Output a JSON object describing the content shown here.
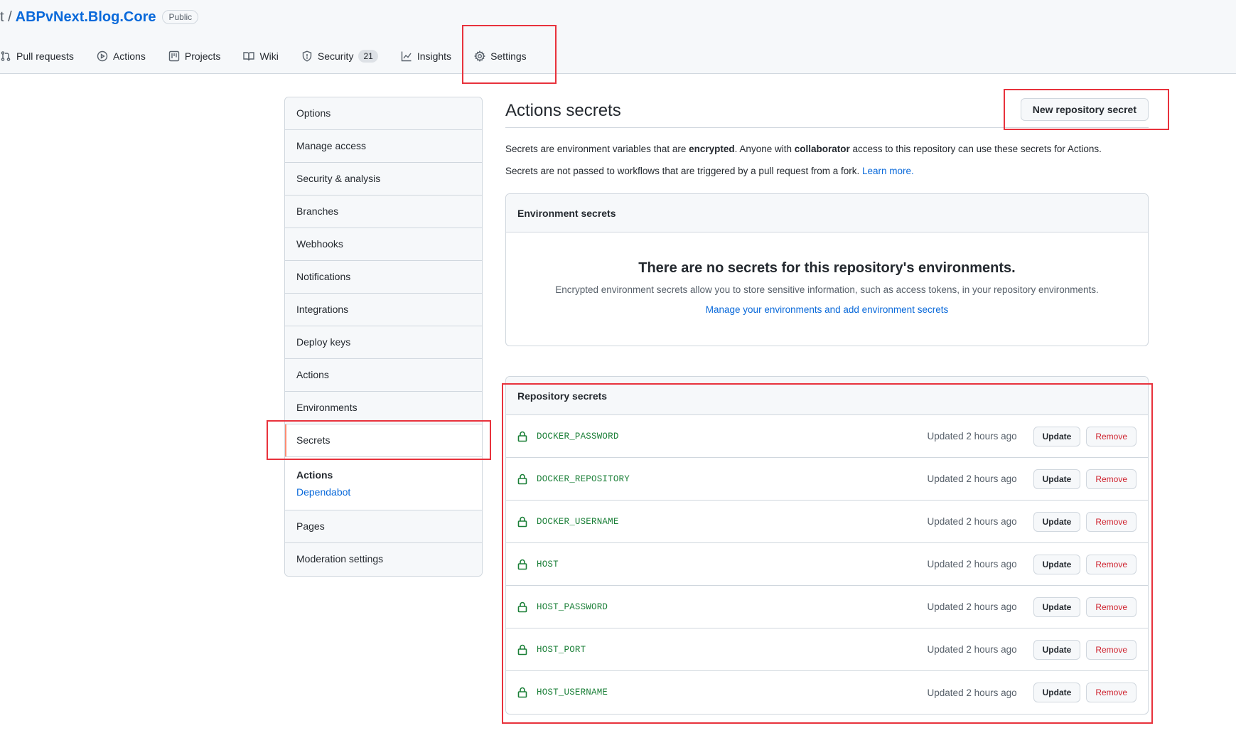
{
  "header": {
    "owner_fragment": "t /",
    "repo_name": "ABPvNext.Blog.Core",
    "visibility": "Public"
  },
  "nav": {
    "tabs": [
      {
        "label": "Pull requests",
        "icon": "pull-request-icon"
      },
      {
        "label": "Actions",
        "icon": "play-icon"
      },
      {
        "label": "Projects",
        "icon": "project-icon"
      },
      {
        "label": "Wiki",
        "icon": "book-icon"
      },
      {
        "label": "Security",
        "icon": "shield-icon",
        "count": "21"
      },
      {
        "label": "Insights",
        "icon": "graph-icon"
      },
      {
        "label": "Settings",
        "icon": "gear-icon"
      }
    ]
  },
  "sidebar": {
    "items": [
      "Options",
      "Manage access",
      "Security & analysis",
      "Branches",
      "Webhooks",
      "Notifications",
      "Integrations",
      "Deploy keys",
      "Actions",
      "Environments",
      "Secrets"
    ],
    "selected": "Secrets",
    "secrets_group": {
      "heading": "Actions",
      "link": "Dependabot"
    },
    "bottom_items": [
      "Pages",
      "Moderation settings"
    ]
  },
  "main": {
    "title": "Actions secrets",
    "new_secret_button": "New repository secret",
    "desc1": {
      "part1": "Secrets are environment variables that are ",
      "bold1": "encrypted",
      "part2": ". Anyone with ",
      "bold2": "collaborator",
      "part3": " access to this repository can use these secrets for Actions."
    },
    "desc2": {
      "text": "Secrets are not passed to workflows that are triggered by a pull request from a fork. ",
      "link": "Learn more."
    },
    "environment_secrets": {
      "header": "Environment secrets",
      "blank_title": "There are no secrets for this repository's environments.",
      "blank_text": "Encrypted environment secrets allow you to store sensitive information, such as access tokens, in your repository environments.",
      "blank_link": "Manage your environments and add environment secrets"
    },
    "repository_secrets": {
      "header": "Repository secrets",
      "update_label": "Update",
      "remove_label": "Remove",
      "rows": [
        {
          "name": "DOCKER_PASSWORD",
          "updated": "Updated 2 hours ago"
        },
        {
          "name": "DOCKER_REPOSITORY",
          "updated": "Updated 2 hours ago"
        },
        {
          "name": "DOCKER_USERNAME",
          "updated": "Updated 2 hours ago"
        },
        {
          "name": "HOST",
          "updated": "Updated 2 hours ago"
        },
        {
          "name": "HOST_PASSWORD",
          "updated": "Updated 2 hours ago"
        },
        {
          "name": "HOST_PORT",
          "updated": "Updated 2 hours ago"
        },
        {
          "name": "HOST_USERNAME",
          "updated": "Updated 2 hours ago"
        }
      ]
    }
  },
  "colors": {
    "link": "#0969da",
    "secret_green": "#1a7f37",
    "danger": "#cf222e",
    "annotation_red": "#e8323c",
    "selected_marker": "#fd8c73"
  }
}
